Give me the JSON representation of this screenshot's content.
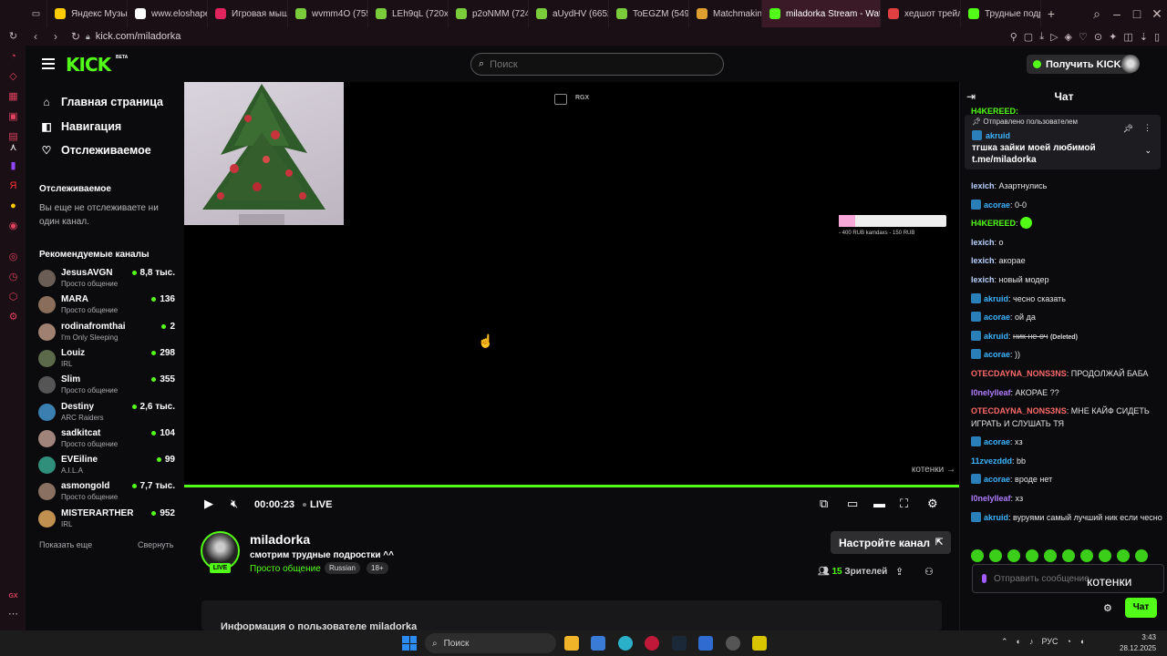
{
  "browser": {
    "tabs": [
      {
        "label": "Яндекс Музыка",
        "color": "#ffcc00"
      },
      {
        "label": "www.eloshape",
        "color": "#ffffff"
      },
      {
        "label": "Игровая мышь",
        "color": "#e0245e"
      },
      {
        "label": "wvmm4O (755",
        "color": "#7acc3c"
      },
      {
        "label": "LEh9qL (720x7",
        "color": "#7acc3c"
      },
      {
        "label": "p2oNMM (724",
        "color": "#7acc3c"
      },
      {
        "label": "aUydHV (665x",
        "color": "#7acc3c"
      },
      {
        "label": "ToEGZM (549x",
        "color": "#7acc3c"
      },
      {
        "label": "Matchmaking",
        "color": "#e0a030"
      },
      {
        "label": "miladorka Stream - Watc",
        "color": "#53fc18"
      },
      {
        "label": "хедшот трейл",
        "color": "#e04040"
      },
      {
        "label": "Трудные подр",
        "color": "#53fc18"
      }
    ],
    "url": "kick.com/miladorka"
  },
  "header": {
    "logo": "KICK",
    "logo_badge": "BETA",
    "search_placeholder": "Поиск",
    "get_kicks": "Получить KICKs"
  },
  "sidebar": {
    "nav": [
      {
        "icon": "home-icon",
        "glyph": "⌂",
        "label": "Главная страница"
      },
      {
        "icon": "compass-icon",
        "glyph": "◧",
        "label": "Навигация"
      },
      {
        "icon": "heart-icon",
        "glyph": "♡",
        "label": "Отслеживаемое"
      }
    ],
    "following_title": "Отслеживаемое",
    "following_empty": "Вы еще не отслеживаете ни один канал.",
    "recommended_title": "Рекомендуемые каналы",
    "channels": [
      {
        "name": "JesusAVGN",
        "category": "Просто общение",
        "viewers": "8,8 тыс."
      },
      {
        "name": "MARA",
        "category": "Просто общение",
        "viewers": "136"
      },
      {
        "name": "rodinafromthai",
        "category": "I'm Only Sleeping",
        "viewers": "2"
      },
      {
        "name": "Louiz",
        "category": "IRL",
        "viewers": "298"
      },
      {
        "name": "Slim",
        "category": "Просто общение",
        "viewers": "355"
      },
      {
        "name": "Destiny",
        "category": "ARC Raiders",
        "viewers": "2,6 тыс."
      },
      {
        "name": "sadkitcat",
        "category": "Просто общение",
        "viewers": "104"
      },
      {
        "name": "EVEiline",
        "category": "A.I.L.A",
        "viewers": "99"
      },
      {
        "name": "asmongold",
        "category": "Просто общение",
        "viewers": "7,7 тыс."
      },
      {
        "name": "MISTERARTHER",
        "category": "IRL",
        "viewers": "952"
      }
    ],
    "show_more": "Показать еще",
    "collapse": "Свернуть"
  },
  "player": {
    "overlay_rgx": "RGX",
    "donation_text": "- 400 RUB  kamdaxs - 150 RUB",
    "video_caption": "котенки →",
    "time": "00:00:23",
    "live_label": "LIVE"
  },
  "channel": {
    "live_badge": "LIVE",
    "name": "miladorka",
    "title": "смотрим трудные подростки ^^",
    "category": "Просто общение",
    "tags": [
      "Russian",
      "18+"
    ],
    "setup_button": "Настройте канал",
    "viewers_count": "15",
    "viewers_label": "Зрителей",
    "about_title": "Информация о пользователе miladorka"
  },
  "chat": {
    "title": "Чат",
    "pinned": {
      "header": "Отправлено пользователем",
      "user": "akruid",
      "message": "тгшка зайки моей любимой t.me/miladorka"
    },
    "top_partial": "H4KEREED:",
    "messages": [
      {
        "user": "lexich",
        "color": "#b9d2ff",
        "badge": false,
        "text": "Азартнулись"
      },
      {
        "user": "acorae",
        "color": "#3cb4ff",
        "badge": true,
        "text": "0-0"
      },
      {
        "user": "H4KEREED",
        "color": "#53fc18",
        "badge": false,
        "text": "",
        "emote": true
      },
      {
        "user": "lexich",
        "color": "#b9d2ff",
        "badge": false,
        "text": "о"
      },
      {
        "user": "lexich",
        "color": "#b9d2ff",
        "badge": false,
        "text": "акорае"
      },
      {
        "user": "lexich",
        "color": "#b9d2ff",
        "badge": false,
        "text": "новый модер"
      },
      {
        "user": "akruid",
        "color": "#3cb4ff",
        "badge": true,
        "text": "чесно сказать"
      },
      {
        "user": "acorae",
        "color": "#3cb4ff",
        "badge": true,
        "text": "ой да"
      },
      {
        "user": "akruid",
        "color": "#3cb4ff",
        "badge": true,
        "text": "ник не оч",
        "deleted": "(Deleted)"
      },
      {
        "user": "acorae",
        "color": "#3cb4ff",
        "badge": true,
        "text": "))"
      },
      {
        "user": "OTECDAYNA_NONS3NS",
        "color": "#ff6a6a",
        "badge": false,
        "text": "ПРОДОЛЖАЙ БАБА"
      },
      {
        "user": "l0nelylleaf",
        "color": "#b07cff",
        "badge": false,
        "text": "АКОРАЕ ??"
      },
      {
        "user": "OTECDAYNA_NONS3NS",
        "color": "#ff6a6a",
        "badge": false,
        "text": "МНЕ КАЙФ СИДЕТЬ ИГРАТЬ И СЛУШАТЬ ТЯ"
      },
      {
        "user": "acorae",
        "color": "#3cb4ff",
        "badge": true,
        "text": "хз"
      },
      {
        "user": "11zvezddd",
        "color": "#3cb4ff",
        "badge": false,
        "text": "bb"
      },
      {
        "user": "acorae",
        "color": "#3cb4ff",
        "badge": true,
        "text": "вроде нет"
      },
      {
        "user": "l0nelylleaf",
        "color": "#b07cff",
        "badge": false,
        "text": "хз"
      },
      {
        "user": "akruid",
        "color": "#3cb4ff",
        "badge": true,
        "text": "вуруями самый лучший ник если чесно"
      }
    ],
    "input_placeholder": "Отправить сообщение",
    "send_label": "Чат",
    "overlay_text": "котенки"
  },
  "taskbar": {
    "search_label": "Поиск",
    "lang": "РУС",
    "time": "3:43",
    "date": "28.12.2025"
  },
  "colors": {
    "accent": "#53fc18",
    "background": "#0b0b0d"
  }
}
